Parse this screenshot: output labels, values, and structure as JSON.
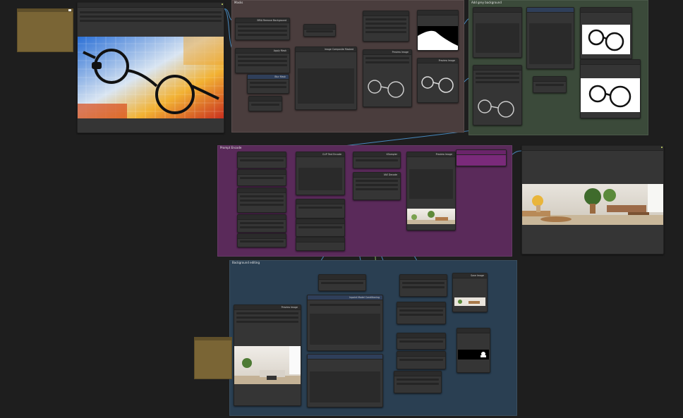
{
  "colors": {
    "canvas_bg": "#1e1e1e",
    "node_bg": "#353535",
    "wire_blue": "#4f9bd9",
    "wire_green": "#9bd36c",
    "wire_orange": "#e2a13a",
    "wire_pink": "#e37cc0",
    "group_brown": "#4a3d3d",
    "group_green": "#3b4a3a",
    "group_purple": "#5a2a5a",
    "group_blue": "#2a3f52"
  },
  "groups": {
    "masks": "Masks",
    "grey_bg": "Add grey background",
    "purple": "Prompt Encode",
    "blue": "Background editing"
  },
  "notes": {
    "top_left": "",
    "bottom": ""
  },
  "nodes": {
    "load_image": "",
    "bria_rmbg": "BRIA Remove Background",
    "apply_mask": "Apply Mask",
    "blur_mask": "Blur Mask",
    "composite": "Image Composite Masked",
    "preview_a": "Preview Image",
    "preview_b": "Preview Image",
    "prompt_clip": "CLIP Text Encode",
    "sampler": "KSampler",
    "vae_decode": "VAE Decode",
    "preview_result": "Preview Image",
    "bg_preview": "Preview Image",
    "inpaint_model": "Inpaint Model Conditioning",
    "save_image": "Save Image"
  },
  "icons": {
    "badge": "status-dot-icon",
    "note": "sticky-note-icon"
  }
}
